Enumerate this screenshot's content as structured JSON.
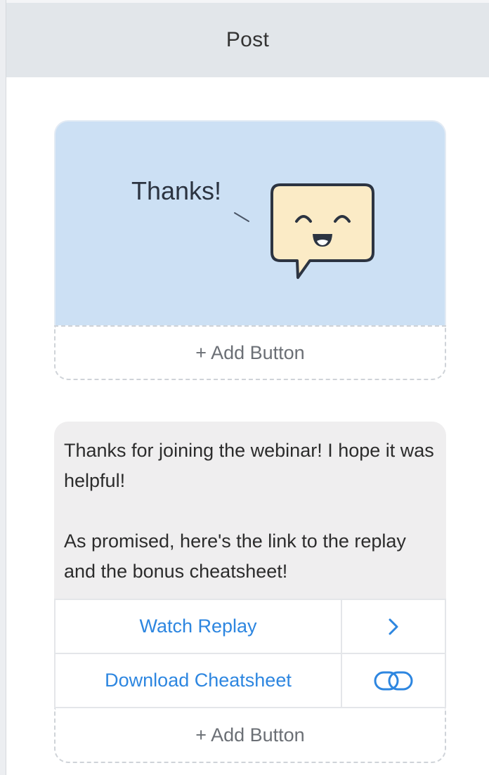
{
  "header": {
    "title": "Post"
  },
  "image_card": {
    "caption": "Thanks!",
    "add_button_label": "+ Add Button"
  },
  "text_card": {
    "paragraph1": "Thanks for joining the webinar! I hope it was helpful!",
    "paragraph2": "As promised, here's the link to the replay and the bonus cheatsheet!",
    "buttons": [
      {
        "label": "Watch Replay",
        "icon": "chevron-right-icon"
      },
      {
        "label": "Download Cheatsheet",
        "icon": "link-icon"
      }
    ],
    "add_button_label": "+ Add Button"
  },
  "colors": {
    "accent": "#2d86e0",
    "image_bg": "#cce0f4",
    "header_bg": "#e2e6ea",
    "text_bg": "#efeeef"
  }
}
